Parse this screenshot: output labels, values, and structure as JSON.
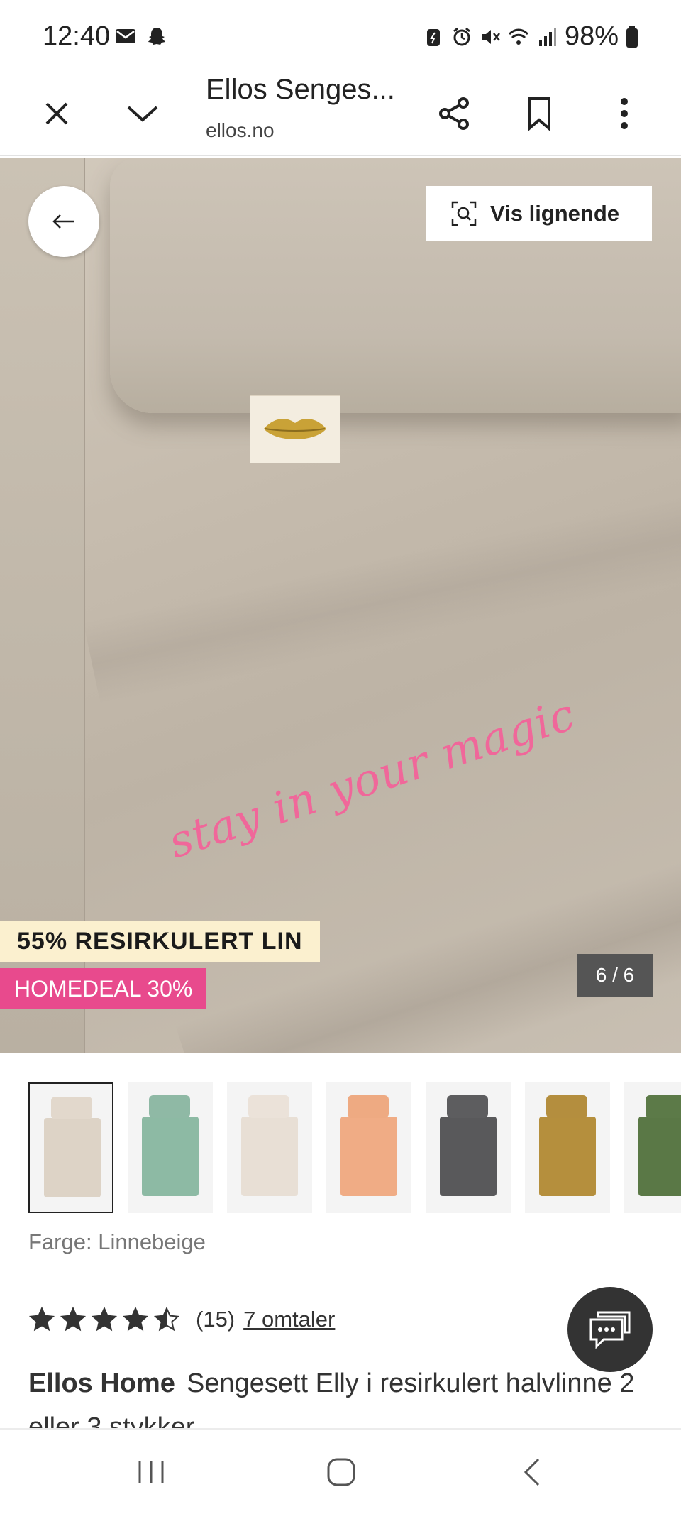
{
  "status_bar": {
    "time": "12:40",
    "battery": "98%",
    "icons": [
      "mail-icon",
      "snapchat-icon",
      "battery-saver-icon",
      "alarm-icon",
      "mute-icon",
      "wifi-icon",
      "signal-icon",
      "battery-icon"
    ]
  },
  "header": {
    "title": "Ellos Senges...",
    "domain": "ellos.no"
  },
  "hero": {
    "embroidery_text": "stay in your magic",
    "visual_search_label": "Vis lignende",
    "badge_material": "55% RESIRKULERT LIN",
    "badge_deal": "HOMEDEAL 30%",
    "image_counter": "6 / 6"
  },
  "thumbnails": [
    {
      "name": "Linnebeige",
      "pillow": "#e2d8cc",
      "duvet": "#ddd3c6",
      "selected": true
    },
    {
      "name": "green",
      "pillow": "#8fb9a5",
      "duvet": "#8dbaa4",
      "selected": false
    },
    {
      "name": "light beige",
      "pillow": "#ebe2d9",
      "duvet": "#e8dfd5",
      "selected": false
    },
    {
      "name": "peach",
      "pillow": "#eeaa82",
      "duvet": "#f0ac85",
      "selected": false
    },
    {
      "name": "dark grey",
      "pillow": "#5d5d5f",
      "duvet": "#59595b",
      "selected": false
    },
    {
      "name": "mustard",
      "pillow": "#b48e3e",
      "duvet": "#b58f3d",
      "selected": false
    },
    {
      "name": "olive",
      "pillow": "#5c7a48",
      "duvet": "#5a7846",
      "selected": false
    }
  ],
  "product": {
    "color_label": "Farge: Linnebeige",
    "rating": 4.5,
    "rating_count": "(15)",
    "reviews_link": "7 omtaler",
    "brand": "Ellos Home",
    "name": "Sengesett Elly i resirkulert halvlinne 2 eller 3 stykker"
  },
  "colors": {
    "deal_pink": "#e84a8d",
    "material_badge_bg": "#fbf0cf",
    "embroidery_pink": "#f0679a"
  }
}
